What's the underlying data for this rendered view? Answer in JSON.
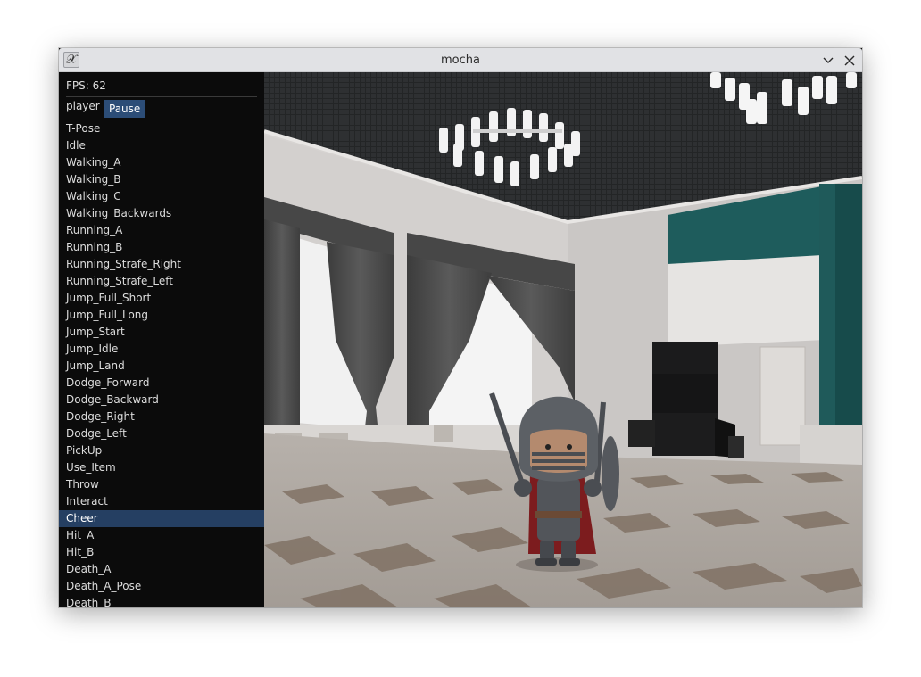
{
  "window": {
    "title": "mocha",
    "app_icon": "x-icon",
    "controls": [
      "minimize-icon",
      "close-icon"
    ]
  },
  "sidebar": {
    "fps_text": "FPS: 62",
    "player_label": "player",
    "pause_label": "Pause",
    "selected": "Cheer",
    "animations": [
      "T-Pose",
      "Idle",
      "Walking_A",
      "Walking_B",
      "Walking_C",
      "Walking_Backwards",
      "Running_A",
      "Running_B",
      "Running_Strafe_Right",
      "Running_Strafe_Left",
      "Jump_Full_Short",
      "Jump_Full_Long",
      "Jump_Start",
      "Jump_Idle",
      "Jump_Land",
      "Dodge_Forward",
      "Dodge_Backward",
      "Dodge_Right",
      "Dodge_Left",
      "PickUp",
      "Use_Item",
      "Throw",
      "Interact",
      "Cheer",
      "Hit_A",
      "Hit_B",
      "Death_A",
      "Death_A_Pose",
      "Death_B"
    ]
  },
  "colors": {
    "selection": "#253f62",
    "pause_button": "#2c4d77",
    "sidebar_bg": "#0b0b0b",
    "curtain_teal": "#1f5a5a"
  }
}
